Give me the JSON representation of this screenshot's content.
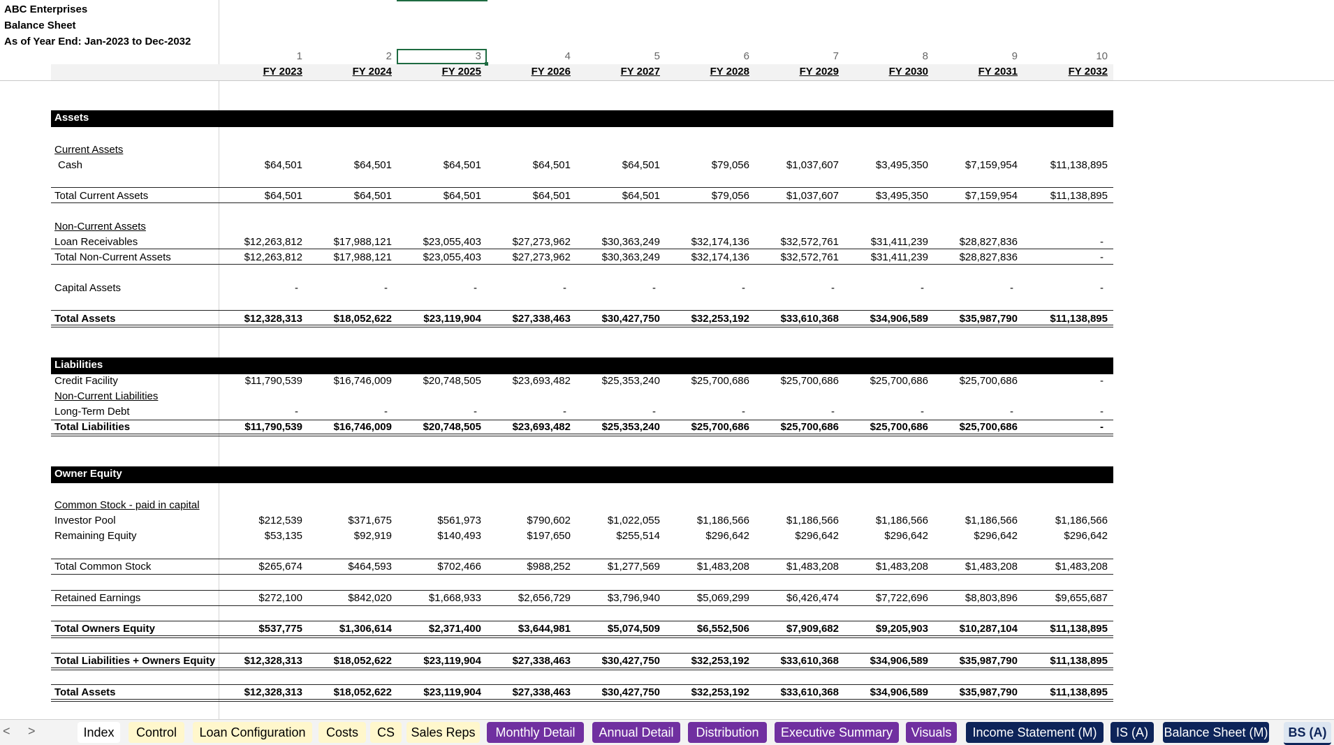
{
  "header": {
    "company": "ABC Enterprises",
    "report": "Balance Sheet",
    "period": "As of Year End: Jan-2023 to Dec-2032"
  },
  "column_numbers": [
    "1",
    "2",
    "3",
    "4",
    "5",
    "6",
    "7",
    "8",
    "9",
    "10"
  ],
  "columns": [
    "FY 2023",
    "FY 2024",
    "FY 2025",
    "FY 2026",
    "FY 2027",
    "FY 2028",
    "FY 2029",
    "FY 2030",
    "FY 2031",
    "FY 2032"
  ],
  "sections": {
    "assets": "Assets",
    "liabilities": "Liabilities",
    "equity": "Owner Equity"
  },
  "subheaders": {
    "current_assets": "Current Assets",
    "non_current_assets": "Non-Current Assets",
    "non_current_liabilities": "Non-Current Liabilities",
    "common_stock": "Common Stock - paid in capital"
  },
  "rows": {
    "cash": {
      "label": "Cash",
      "values": [
        "$64,501",
        "$64,501",
        "$64,501",
        "$64,501",
        "$64,501",
        "$79,056",
        "$1,037,607",
        "$3,495,350",
        "$7,159,954",
        "$11,138,895"
      ]
    },
    "total_current_assets": {
      "label": "Total Current Assets",
      "values": [
        "$64,501",
        "$64,501",
        "$64,501",
        "$64,501",
        "$64,501",
        "$79,056",
        "$1,037,607",
        "$3,495,350",
        "$7,159,954",
        "$11,138,895"
      ]
    },
    "loan_receivables": {
      "label": "Loan Receivables",
      "values": [
        "$12,263,812",
        "$17,988,121",
        "$23,055,403",
        "$27,273,962",
        "$30,363,249",
        "$32,174,136",
        "$32,572,761",
        "$31,411,239",
        "$28,827,836",
        "-"
      ]
    },
    "total_non_current_assets": {
      "label": "Total Non-Current Assets",
      "values": [
        "$12,263,812",
        "$17,988,121",
        "$23,055,403",
        "$27,273,962",
        "$30,363,249",
        "$32,174,136",
        "$32,572,761",
        "$31,411,239",
        "$28,827,836",
        "-"
      ]
    },
    "capital_assets": {
      "label": "Capital Assets",
      "values": [
        "-",
        "-",
        "-",
        "-",
        "-",
        "-",
        "-",
        "-",
        "-",
        "-"
      ]
    },
    "total_assets": {
      "label": "Total Assets",
      "values": [
        "$12,328,313",
        "$18,052,622",
        "$23,119,904",
        "$27,338,463",
        "$30,427,750",
        "$32,253,192",
        "$33,610,368",
        "$34,906,589",
        "$35,987,790",
        "$11,138,895"
      ]
    },
    "credit_facility": {
      "label": "Credit Facility",
      "values": [
        "$11,790,539",
        "$16,746,009",
        "$20,748,505",
        "$23,693,482",
        "$25,353,240",
        "$25,700,686",
        "$25,700,686",
        "$25,700,686",
        "$25,700,686",
        "-"
      ]
    },
    "long_term_debt": {
      "label": "Long-Term Debt",
      "values": [
        "-",
        "-",
        "-",
        "-",
        "-",
        "-",
        "-",
        "-",
        "-",
        "-"
      ]
    },
    "total_liabilities": {
      "label": "Total Liabilities",
      "values": [
        "$11,790,539",
        "$16,746,009",
        "$20,748,505",
        "$23,693,482",
        "$25,353,240",
        "$25,700,686",
        "$25,700,686",
        "$25,700,686",
        "$25,700,686",
        "-"
      ]
    },
    "investor_pool": {
      "label": "Investor Pool",
      "values": [
        "$212,539",
        "$371,675",
        "$561,973",
        "$790,602",
        "$1,022,055",
        "$1,186,566",
        "$1,186,566",
        "$1,186,566",
        "$1,186,566",
        "$1,186,566"
      ]
    },
    "remaining_equity": {
      "label": "Remaining Equity",
      "values": [
        "$53,135",
        "$92,919",
        "$140,493",
        "$197,650",
        "$255,514",
        "$296,642",
        "$296,642",
        "$296,642",
        "$296,642",
        "$296,642"
      ]
    },
    "total_common_stock": {
      "label": "Total Common Stock",
      "values": [
        "$265,674",
        "$464,593",
        "$702,466",
        "$988,252",
        "$1,277,569",
        "$1,483,208",
        "$1,483,208",
        "$1,483,208",
        "$1,483,208",
        "$1,483,208"
      ]
    },
    "retained_earnings": {
      "label": "Retained Earnings",
      "values": [
        "$272,100",
        "$842,020",
        "$1,668,933",
        "$2,656,729",
        "$3,796,940",
        "$5,069,299",
        "$6,426,474",
        "$7,722,696",
        "$8,803,896",
        "$9,655,687"
      ]
    },
    "total_owners_equity": {
      "label": "Total Owners Equity",
      "values": [
        "$537,775",
        "$1,306,614",
        "$2,371,400",
        "$3,644,981",
        "$5,074,509",
        "$6,552,506",
        "$7,909,682",
        "$9,205,903",
        "$10,287,104",
        "$11,138,895"
      ]
    },
    "total_liab_equity": {
      "label": "Total Liabilities + Owners Equity",
      "values": [
        "$12,328,313",
        "$18,052,622",
        "$23,119,904",
        "$27,338,463",
        "$30,427,750",
        "$32,253,192",
        "$33,610,368",
        "$34,906,589",
        "$35,987,790",
        "$11,138,895"
      ]
    },
    "total_assets_check": {
      "label": "Total Assets",
      "values": [
        "$12,328,313",
        "$18,052,622",
        "$23,119,904",
        "$27,338,463",
        "$30,427,750",
        "$32,253,192",
        "$33,610,368",
        "$34,906,589",
        "$35,987,790",
        "$11,138,895"
      ]
    }
  },
  "tabs": [
    {
      "label": "Index",
      "style": "white"
    },
    {
      "label": "Control",
      "style": "yellow"
    },
    {
      "label": "Loan Configuration",
      "style": "yellow"
    },
    {
      "label": "Costs",
      "style": "yellow"
    },
    {
      "label": "CS",
      "style": "yellow"
    },
    {
      "label": "Sales Reps",
      "style": "yellow"
    },
    {
      "label": "Monthly Detail",
      "style": "purple"
    },
    {
      "label": "Annual Detail",
      "style": "purple"
    },
    {
      "label": "Distribution",
      "style": "purple"
    },
    {
      "label": "Executive Summary",
      "style": "purple"
    },
    {
      "label": "Visuals",
      "style": "purple"
    },
    {
      "label": "Income Statement (M)",
      "style": "navy"
    },
    {
      "label": "IS (A)",
      "style": "navy"
    },
    {
      "label": "Balance Sheet (M)",
      "style": "navy"
    },
    {
      "label": "BS (A)",
      "style": "active"
    }
  ],
  "nav": {
    "prev": "<",
    "next": ">"
  },
  "colors": {
    "purple": "#7030a0",
    "navy": "#0d2459",
    "yellow": "#fff7cc",
    "selection": "#1e6b41"
  }
}
